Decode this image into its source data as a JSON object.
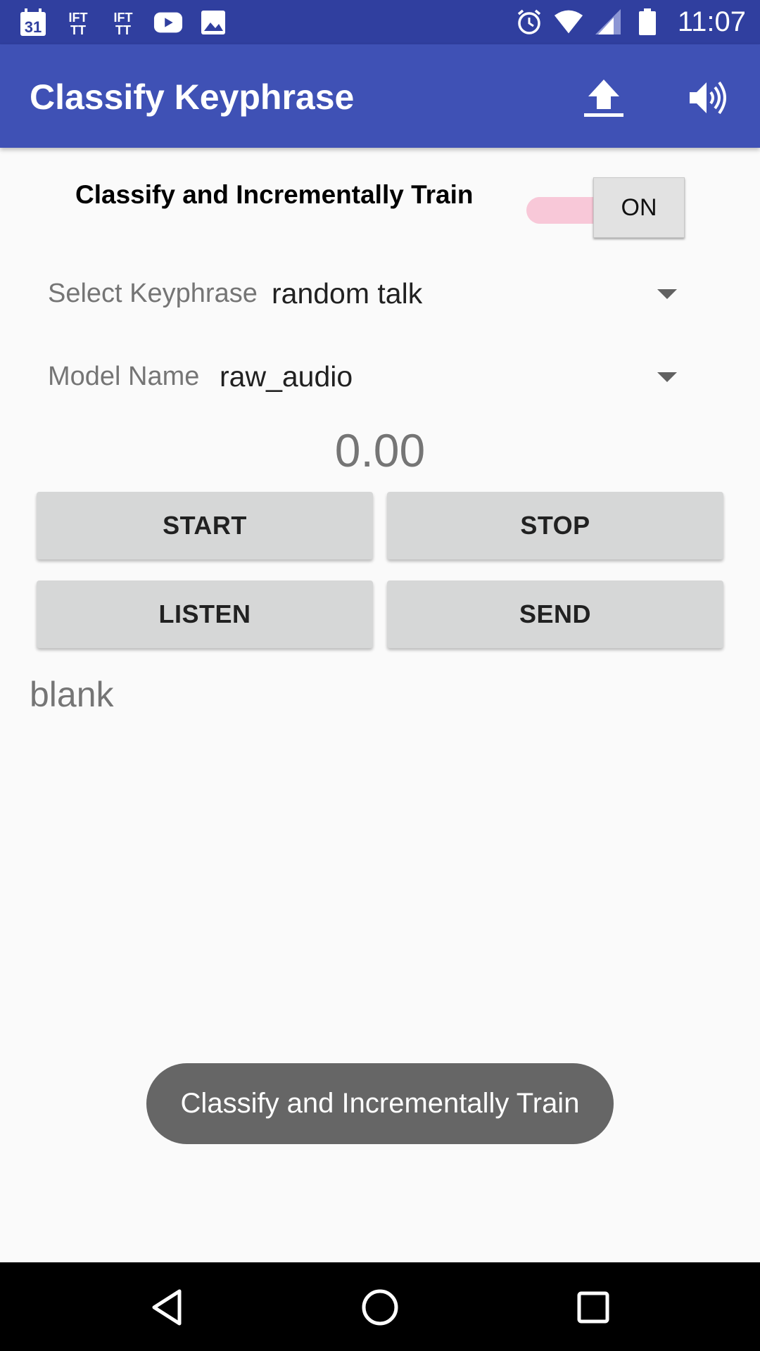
{
  "status_bar": {
    "time": "11:07",
    "calendar_day": "31",
    "ifttt_1": "IFT TT",
    "ifttt_2": "IFT TT",
    "icons_left": [
      "calendar-icon",
      "ifttt-icon",
      "ifttt-icon",
      "youtube-icon",
      "image-icon"
    ],
    "icons_right": [
      "alarm-icon",
      "wifi-icon",
      "signal-icon",
      "battery-icon"
    ]
  },
  "app_bar": {
    "title": "Classify Keyphrase",
    "actions": [
      "upload-icon",
      "volume-icon"
    ]
  },
  "toggle": {
    "label": "Classify and Incrementally Train",
    "state_text": "ON",
    "checked": true
  },
  "keyphrase_spinner": {
    "label": "Select Keyphrase",
    "value": "random talk"
  },
  "model_spinner": {
    "label": "Model Name",
    "value": "raw_audio"
  },
  "score": "0.00",
  "buttons": {
    "start": "START",
    "stop": "STOP",
    "listen": "LISTEN",
    "send": "SEND"
  },
  "result_text": "blank",
  "toast": "Classify and Incrementally Train",
  "nav_bar": {
    "buttons": [
      "back-icon",
      "home-icon",
      "recents-icon"
    ]
  },
  "colors": {
    "status_bar": "#303f9f",
    "app_bar": "#3f51b5",
    "toggle_track": "#f8c8d8",
    "button_bg": "#d6d7d7",
    "toast_bg": "#666666"
  }
}
